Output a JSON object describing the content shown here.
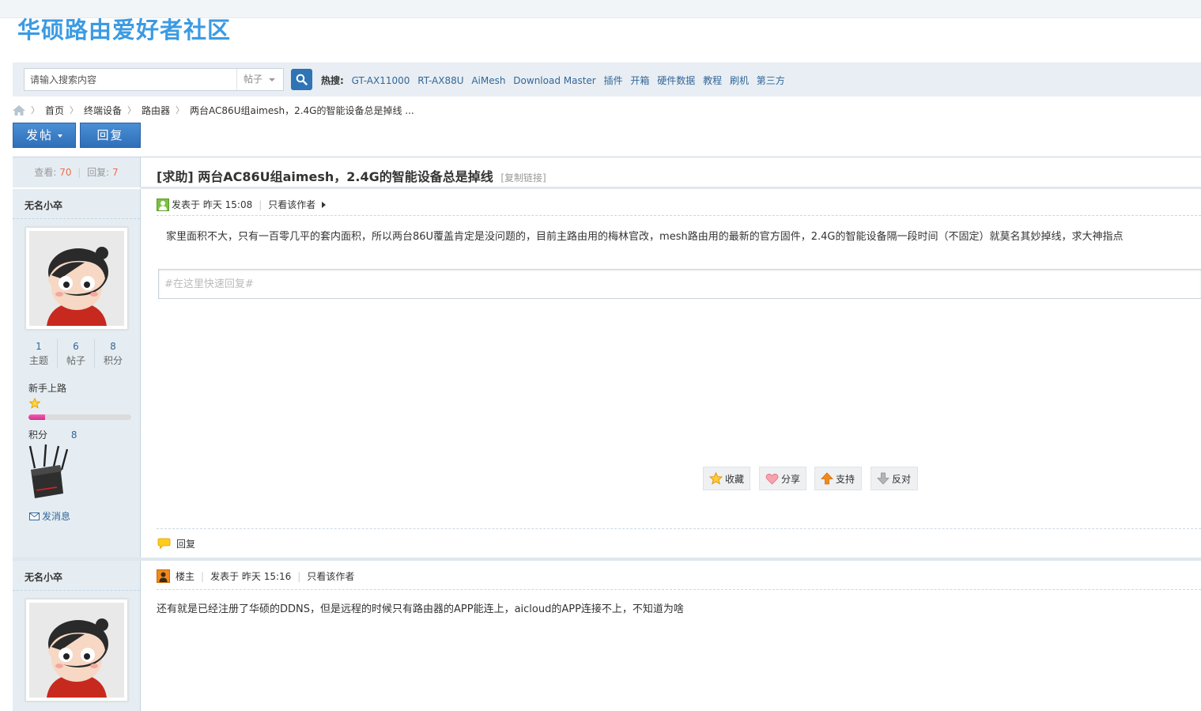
{
  "site": {
    "title": "华硕路由爱好者社区"
  },
  "search": {
    "placeholder": "请输入搜索内容",
    "type": "帖子",
    "hot_label": "热搜:",
    "hot_terms": [
      "GT-AX11000",
      "RT-AX88U",
      "AiMesh",
      "Download Master",
      "插件",
      "开箱",
      "硬件数据",
      "教程",
      "刷机",
      "第三方"
    ]
  },
  "breadcrumb": [
    "首页",
    "终端设备",
    "路由器",
    "两台AC86U组aimesh，2.4G的智能设备总是掉线 ..."
  ],
  "toolbar": {
    "post_label": "发帖",
    "reply_label": "回复"
  },
  "thread": {
    "views_label": "查看:",
    "views": "70",
    "replies_label": "回复:",
    "replies": "7",
    "title": "[求助] 两台AC86U组aimesh，2.4G的智能设备总是掉线",
    "copy_link": "[复制链接]"
  },
  "posts": [
    {
      "author": "无名小卒",
      "stats": [
        {
          "value": "1",
          "label": "主题"
        },
        {
          "value": "6",
          "label": "帖子"
        },
        {
          "value": "8",
          "label": "积分"
        }
      ],
      "rank": "新手上路",
      "level_fraction": 0.16,
      "score_label": "积分",
      "score": "8",
      "send_msg": "发消息",
      "posted": "发表于 昨天 15:08",
      "only_author": "只看该作者",
      "body": "家里面积不大，只有一百零几平的套内面积，所以两台86U覆盖肯定是没问题的，目前主路由用的梅林官改，mesh路由用的最新的官方固件，2.4G的智能设备隔一段时间（不固定）就莫名其妙掉线，求大神指点",
      "quick_reply_placeholder": "#在这里快速回复#",
      "actions": {
        "fav": "收藏",
        "share": "分享",
        "up": "支持",
        "down": "反对"
      },
      "reply": "回复"
    },
    {
      "author": "无名小卒",
      "badge": "楼主",
      "posted": "发表于 昨天 15:16",
      "only_author": "只看该作者",
      "body": "还有就是已经注册了华硕的DDNS，但是远程的时候只有路由器的APP能连上，aicloud的APP连接不上，不知道为啥"
    }
  ]
}
